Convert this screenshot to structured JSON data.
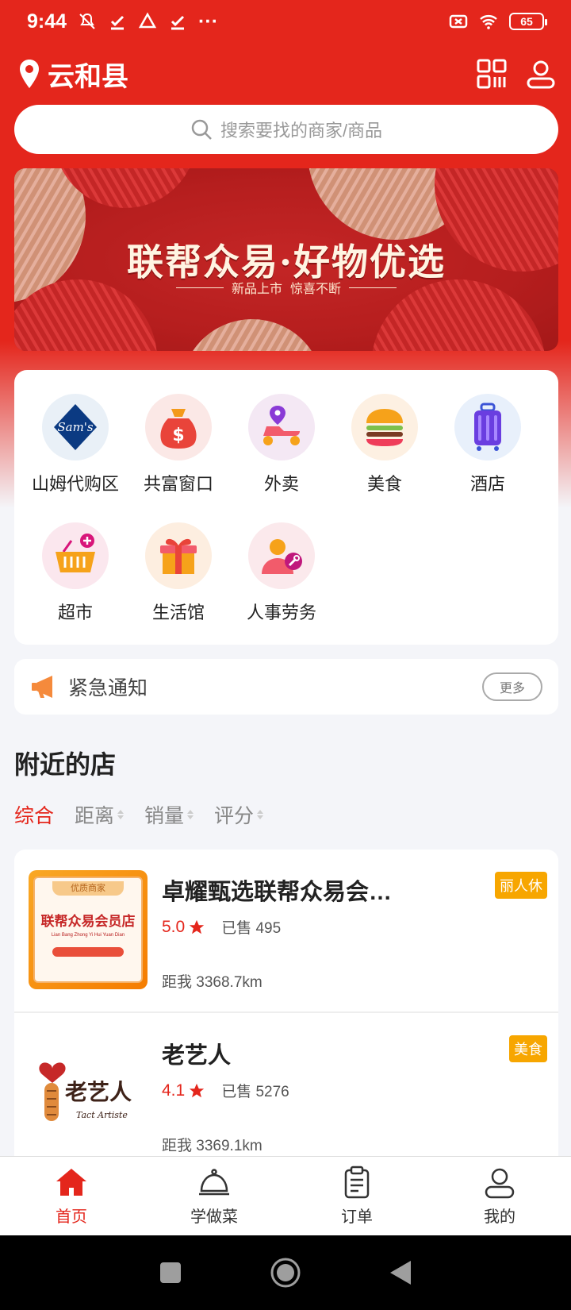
{
  "status_bar": {
    "time": "9:44",
    "battery": "65"
  },
  "location": {
    "name": "云和县"
  },
  "search": {
    "placeholder": "搜索要找的商家/商品"
  },
  "banner": {
    "title": "联帮众易·好物优选",
    "sub_left": "新品上市",
    "sub_right": "惊喜不断"
  },
  "categories": [
    {
      "label": "山姆代购区",
      "icon": "sams-club-icon"
    },
    {
      "label": "共富窗口",
      "icon": "money-bag-icon"
    },
    {
      "label": "外卖",
      "icon": "scooter-icon"
    },
    {
      "label": "美食",
      "icon": "burger-icon"
    },
    {
      "label": "酒店",
      "icon": "luggage-icon"
    },
    {
      "label": "超市",
      "icon": "basket-icon"
    },
    {
      "label": "生活馆",
      "icon": "gift-icon"
    },
    {
      "label": "人事劳务",
      "icon": "worker-icon"
    }
  ],
  "notice": {
    "title": "紧急通知",
    "more": "更多"
  },
  "nearby": {
    "title": "附近的店",
    "sorts": [
      "综合",
      "距离",
      "销量",
      "评分"
    ]
  },
  "stores": [
    {
      "name": "卓耀甄选联帮众易会…",
      "tag": "丽人休",
      "rating": "5.0",
      "sold": "已售 495",
      "distance": "距我 3368.7km",
      "logo_text": "联帮众易会员店",
      "logo_pinyin": "Lian  Bang Zhong  Yi   Hui   Yuan Dian",
      "logo_badge": "优质商家"
    },
    {
      "name": "老艺人",
      "tag": "美食",
      "rating": "4.1",
      "sold": "已售 5276",
      "distance": "距我 3369.1km",
      "logo_text": "老艺人",
      "logo_pinyin": "Tact Artiste"
    }
  ],
  "tabs": [
    {
      "label": "首页",
      "icon": "home-icon"
    },
    {
      "label": "学做菜",
      "icon": "cloche-icon"
    },
    {
      "label": "订单",
      "icon": "clipboard-icon"
    },
    {
      "label": "我的",
      "icon": "user-icon"
    }
  ],
  "colors": {
    "brand": "#e4261c",
    "tag": "#f7a600"
  }
}
